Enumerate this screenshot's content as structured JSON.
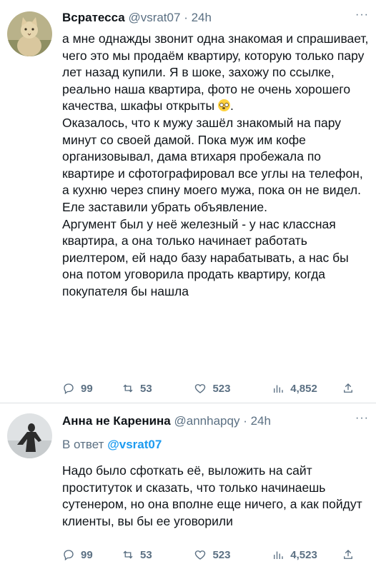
{
  "tweets": [
    {
      "name": "Всратесса",
      "handle": "@vsrat07",
      "sep": "·",
      "time": "24h",
      "text_parts": {
        "part1": "а мне однажды звонит одна знакомая и спрашивает, чего это мы продаём квартиру, которую только пару лет назад купили. Я в шоке, захожу по ссылке, реально наша квартира, фото не очень хорошего качества, шкафы открыты",
        "emoji": "flushed-face-emoji",
        "part2": ".\nОказалось, что к мужу зашёл знакомый на пару минут со своей дамой. Пока муж им кофе организовывал, дама втихаря пробежала по квартире и сфотографировал все углы на телефон, а кухню через спину моего мужа, пока он не видел. Еле заставили убрать объявление.\nАргумент был у неё железный - у нас классная квартира, а она только начинает работать риелтером, ей надо базу нарабатывать, а нас бы она потом уговорила продать квартиру, когда покупателя бы нашла"
      },
      "stats": {
        "replies": "99",
        "retweets": "53",
        "likes": "523",
        "views": "4,852"
      }
    },
    {
      "name": "Анна не Каренина",
      "handle": "@annhapqy",
      "sep": "·",
      "time": "24h",
      "reply_prefix": "В ответ",
      "reply_to": "@vsrat07",
      "text": "Надо было сфоткать её, выложить на сайт проституток и сказать, что только начинаешь сутенером, но она вполне еще ничего, а как пойдут клиенты, вы бы ее уговорили",
      "stats": {
        "replies": "99",
        "retweets": "53",
        "likes": "523",
        "views": "4,523"
      }
    }
  ],
  "more_label": "···",
  "colors": {
    "accent": "#1d9bf0",
    "secondary": "#5b7083",
    "text": "#0f1419"
  }
}
